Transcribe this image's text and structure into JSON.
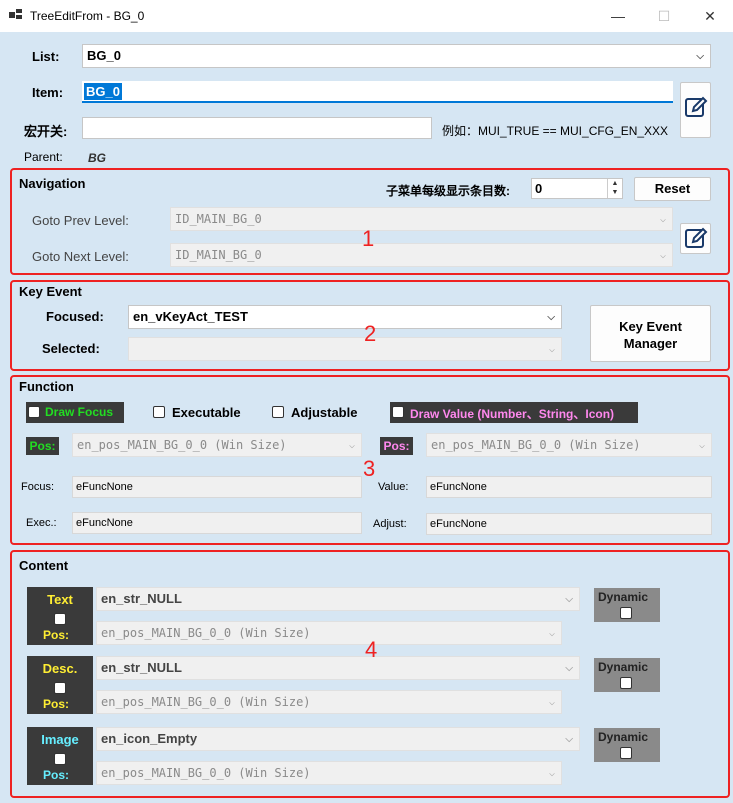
{
  "window": {
    "title": "TreeEditFrom - BG_0",
    "min": "—",
    "max": "☐",
    "close": "✕"
  },
  "list": {
    "label": "List:",
    "value": "BG_0"
  },
  "item": {
    "label": "Item:",
    "value": "BG_0"
  },
  "macro": {
    "label": "宏开关:",
    "value": "",
    "example": "例如：MUI_TRUE == MUI_CFG_EN_XXX"
  },
  "parent": {
    "label": "Parent:",
    "value": "BG"
  },
  "navigation": {
    "title": "Navigation",
    "count_label": "子菜单每级显示条目数:",
    "count_value": "0",
    "reset_label": "Reset",
    "prev_label": "Goto Prev  Level:",
    "prev_value": "ID_MAIN_BG_0",
    "next_label": "Goto Next Level:",
    "next_value": "ID_MAIN_BG_0",
    "marker": "1"
  },
  "key_event": {
    "title": "Key Event",
    "focused_label": "Focused:",
    "focused_value": "en_vKeyAct_TEST",
    "selected_label": "Selected:",
    "selected_value": "",
    "manager_label_1": "Key Event",
    "manager_label_2": "Manager",
    "marker": "2"
  },
  "function": {
    "title": "Function",
    "draw_focus": "Draw Focus",
    "executable": "Executable",
    "adjustable": "Adjustable",
    "draw_value": "Draw Value (Number、String、Icon)",
    "pos_label_left": "Pos:",
    "pos_value_left": "en_pos_MAIN_BG_0_0 (Win Size)",
    "pos_label_right": "Pos:",
    "pos_value_right": "en_pos_MAIN_BG_0_0 (Win Size)",
    "focus_label": "Focus:",
    "focus_value": "eFuncNone",
    "value_label": "Value:",
    "value_value": "eFuncNone",
    "exec_label": "Exec.:",
    "exec_value": "eFuncNone",
    "adjust_label": "Adjust:",
    "adjust_value": "eFuncNone",
    "marker": "3"
  },
  "content": {
    "title": "Content",
    "rows": [
      {
        "label": "Text",
        "pos_label": "Pos:",
        "value": "en_str_NULL",
        "pos_value": "en_pos_MAIN_BG_0_0 (Win Size)",
        "dynamic": "Dynamic"
      },
      {
        "label": "Desc.",
        "pos_label": "Pos:",
        "value": "en_str_NULL",
        "pos_value": "en_pos_MAIN_BG_0_0 (Win Size)",
        "dynamic": "Dynamic"
      },
      {
        "label": "Image",
        "pos_label": "Pos:",
        "value": "en_icon_Empty",
        "pos_value": "en_pos_MAIN_BG_0_0 (Win Size)",
        "dynamic": "Dynamic"
      }
    ],
    "marker": "4"
  },
  "colors": {
    "accent_green": "#22dd22",
    "accent_pink": "#ff88ee",
    "accent_yellow": "#ffee33",
    "accent_cyan": "#66eeff",
    "red_outline": "#ee2222"
  }
}
